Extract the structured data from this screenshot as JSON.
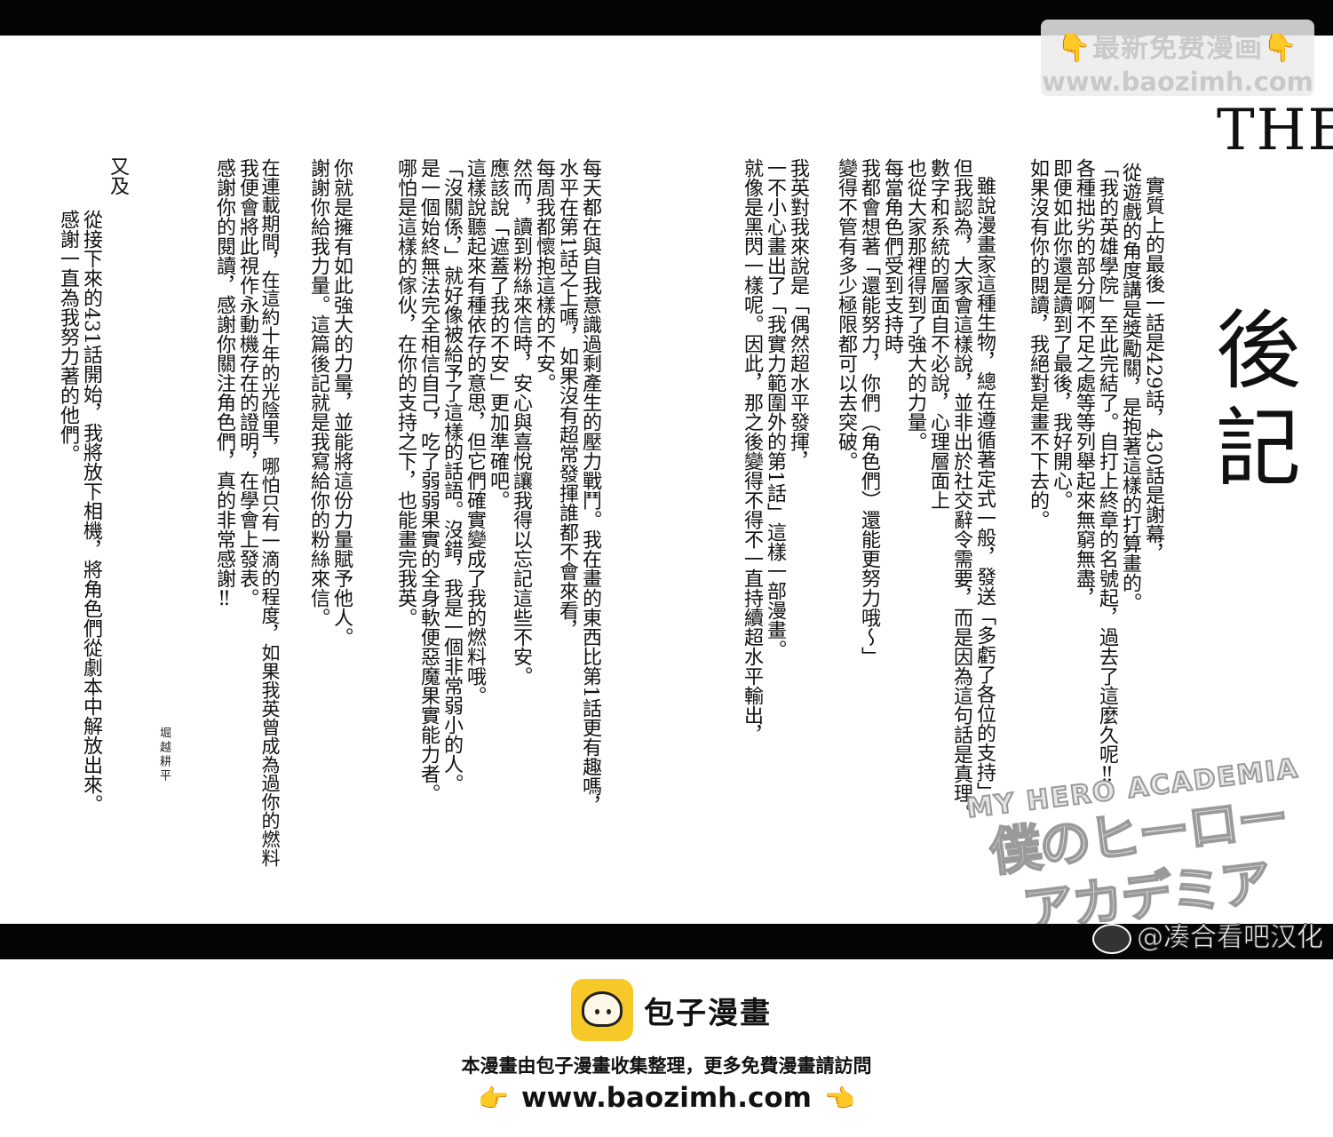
{
  "watermark": {
    "line1": "最新免费漫画",
    "line2": "www.baozimh.com",
    "hand_icon": "pointing-down-hand"
  },
  "title": {
    "latin": "THE·",
    "kanji": "後記"
  },
  "columns": [
    "實質上的最後一話是429話，430話是謝幕，",
    "從遊戲的角度講是獎勵關，是抱著這樣的打算畫的。",
    "「我的英雄學院」至此完結了。自打上終章的名號起，過去了這麼久呢‼",
    "各種拙劣的部分啊不足之處等等列舉起來無窮無盡，",
    "即便如此你還是讀到了最後，我好開心。",
    "如果沒有你的閱讀，我絕對是畫不下去的。",
    "雖說漫畫家這種生物，總在遵循著定式一般，發送「多虧了各位的支持」",
    "但我認為，大家會這樣說，並非出於社交辭令需要，而是因為這句話是真理。",
    "數字和系統的層面自不必說，心理層面上",
    "也從大家那裡得到了強大的力量。",
    "每當角色們受到支持時",
    "我都會想著「還能努力，你們（角色們）還能更努力哦～」",
    "變得不管有多少極限都可以去突破。",
    "我英對我來說是「偶然超水平發揮，",
    "一不小心畫出了「我實力範圍外的第1話」這樣一部漫畫。",
    "就像是黑閃一樣呢。因此，那之後變得不得不一直持續超水平輸出，",
    "每天都在與自我意識過剩產生的壓力戰鬥。我在畫的東西比第1話更有趣嗎，",
    "水平在第1話之上嗎，如果沒有超常發揮誰都不會來看，",
    "每周我都懷抱這樣的不安。",
    "然而，讀到粉絲來信時，安心與喜悅讓我得以忘記這些不安。",
    "應該說「遮蓋了我的不安」更加準確吧。",
    "這樣說聽起來有種依存的意思，但它們確實變成了我的燃料哦。",
    "「沒關係，」就好像被給予了這樣的話語。沒錯，我是一個非常弱小的人。",
    "是一個始終無法完全相信自己，吃了弱弱果實的全身軟便惡魔果實能力者。",
    "哪怕是這樣的傢伙，在你的支持之下，也能畫完我英。",
    "你就是擁有如此強大的力量，並能將這份力量賦予他人。",
    "謝謝你給我力量。這篇後記就是我寫給你的粉絲來信。",
    "在連載期間，在這約十年的光陰里，哪怕只有一滴的程度，如果我英曾成為過你的燃料",
    "我便會將此視作永動機存在的證明，在學會上發表。",
    "感謝你的閱讀，感謝你關注角色們，真的非常感謝‼",
    "又及",
    "從接下來的431話開始，我將放下相機，將角色們從劇本中解放出來。",
    "感謝一直為我努力著的他們。"
  ],
  "author": "堀越耕平",
  "logo": {
    "english": "MY HERO ACADEMIA",
    "japanese": "僕のヒーローアカデミア"
  },
  "credit": {
    "text": "@凑合看吧汉化",
    "icon": "weibo-icon"
  },
  "footer": {
    "brand_name": "包子漫畫",
    "brand_icon": "bun-mascot",
    "note": "本漫畫由包子漫畫收集整理，更多免費漫畫請訪問",
    "url": "www.baozimh.com",
    "hand_icon": "pointing-hand"
  },
  "colors": {
    "bars": "#050505",
    "brand_yellow": "#f6c928",
    "hand": "#f2b000"
  }
}
